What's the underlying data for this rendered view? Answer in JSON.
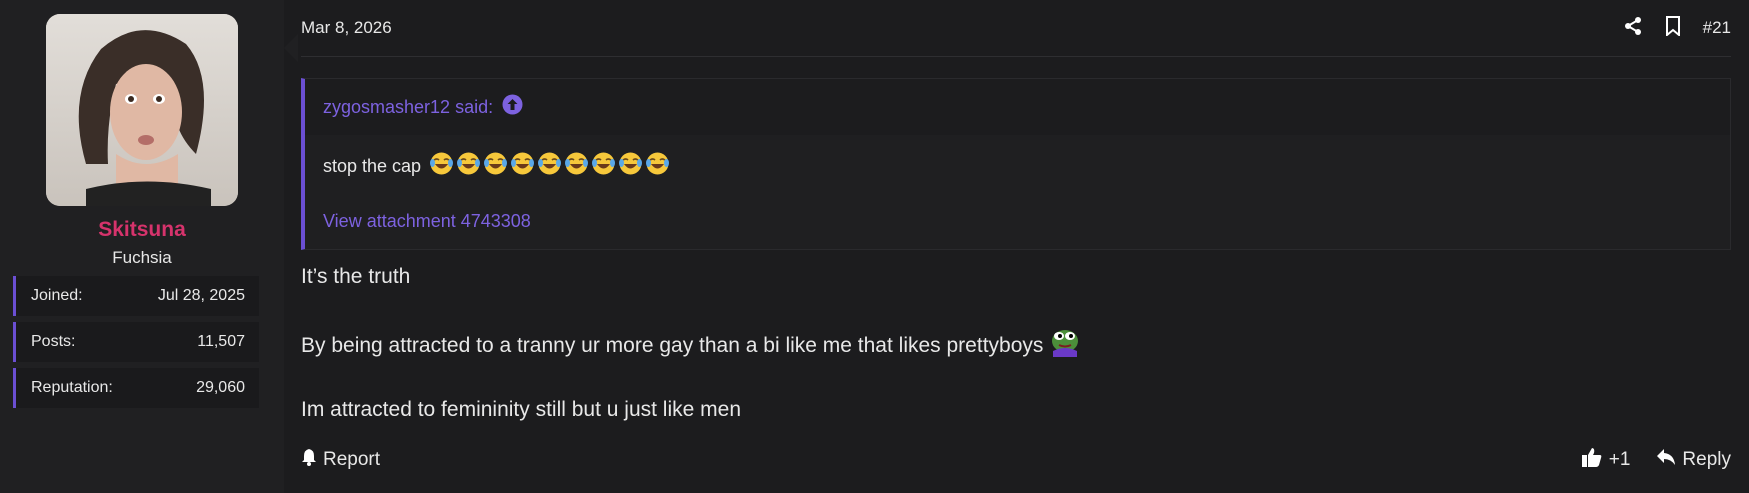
{
  "user": {
    "name": "Skitsuna",
    "title": "Fuchsia",
    "stats": [
      {
        "label": "Joined:",
        "value": "Jul 28, 2025"
      },
      {
        "label": "Posts:",
        "value": "11,507"
      },
      {
        "label": "Reputation:",
        "value": "29,060"
      }
    ]
  },
  "post": {
    "date": "Mar 8, 2026",
    "number": "#21",
    "quote": {
      "author": "zygosmasher12 said:",
      "text": "stop the cap",
      "emoji_count": 9,
      "attachment": "View attachment 4743308"
    },
    "body": [
      "It’s the truth",
      "By being attracted to a tranny ur more gay than a bi like me that likes prettyboys",
      "Im attracted to femininity still but u just like men"
    ]
  },
  "footer": {
    "report": "Report",
    "likes": "+1",
    "reply": "Reply"
  },
  "colors": {
    "accent": "#6b4fd3",
    "link": "#7d62e0",
    "username": "#d6336c"
  }
}
